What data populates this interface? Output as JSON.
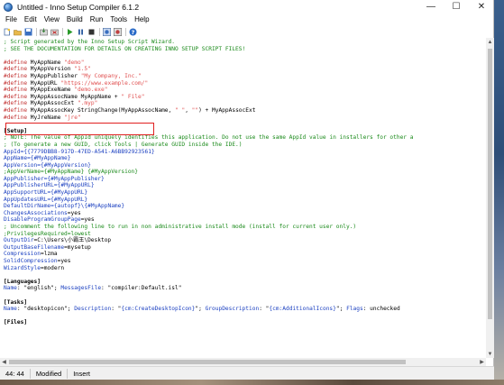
{
  "window": {
    "title": "Untitled - Inno Setup Compiler 6.1.2",
    "controls": {
      "minimize": "—",
      "maximize": "☐",
      "close": "✕"
    }
  },
  "menu": [
    "File",
    "Edit",
    "View",
    "Build",
    "Run",
    "Tools",
    "Help"
  ],
  "toolbar": {
    "icons": [
      "new-icon",
      "open-icon",
      "save-icon",
      "compile-icon",
      "stop-compile-icon",
      "run-icon",
      "pause-icon",
      "terminate-icon",
      "target-icon",
      "debug-icon",
      "help-icon"
    ]
  },
  "editor": {
    "lines": [
      [
        {
          "t": "; Script generated by the Inno Setup Script Wizard.",
          "c": "comment"
        }
      ],
      [
        {
          "t": "; SEE THE DOCUMENTATION FOR DETAILS ON CREATING INNO SETUP SCRIPT FILES!",
          "c": "comment"
        }
      ],
      [
        {
          "t": "",
          "c": "plain"
        }
      ],
      [
        {
          "t": "#define",
          "c": "define"
        },
        {
          "t": " MyAppName ",
          "c": "plain"
        },
        {
          "t": "\"demo\"",
          "c": "str"
        }
      ],
      [
        {
          "t": "#define",
          "c": "define"
        },
        {
          "t": " MyAppVersion ",
          "c": "plain"
        },
        {
          "t": "\"1.5\"",
          "c": "str"
        }
      ],
      [
        {
          "t": "#define",
          "c": "define"
        },
        {
          "t": " MyAppPublisher ",
          "c": "plain"
        },
        {
          "t": "\"My Company, Inc.\"",
          "c": "str"
        }
      ],
      [
        {
          "t": "#define",
          "c": "define"
        },
        {
          "t": " MyAppURL ",
          "c": "plain"
        },
        {
          "t": "\"https://www.example.com/\"",
          "c": "str"
        }
      ],
      [
        {
          "t": "#define",
          "c": "define"
        },
        {
          "t": " MyAppExeName ",
          "c": "plain"
        },
        {
          "t": "\"demo.exe\"",
          "c": "str"
        }
      ],
      [
        {
          "t": "#define",
          "c": "define"
        },
        {
          "t": " MyAppAssocName MyAppName + ",
          "c": "plain"
        },
        {
          "t": "\" File\"",
          "c": "str"
        }
      ],
      [
        {
          "t": "#define",
          "c": "define"
        },
        {
          "t": " MyAppAssocExt ",
          "c": "plain"
        },
        {
          "t": "\".myp\"",
          "c": "str"
        }
      ],
      [
        {
          "t": "#define",
          "c": "define"
        },
        {
          "t": " MyAppAssocKey StringChange(MyAppAssocName, ",
          "c": "plain"
        },
        {
          "t": "\" \"",
          "c": "str"
        },
        {
          "t": ", ",
          "c": "plain"
        },
        {
          "t": "\"\"",
          "c": "str"
        },
        {
          "t": ") + MyAppAssocExt",
          "c": "plain"
        }
      ],
      [
        {
          "t": "#define",
          "c": "define"
        },
        {
          "t": " MyJreName ",
          "c": "plain"
        },
        {
          "t": "\"jre\"",
          "c": "str"
        }
      ],
      [
        {
          "t": "",
          "c": "plain"
        }
      ],
      [
        {
          "t": "[Setup]",
          "c": "sec"
        }
      ],
      [
        {
          "t": "; NOTE: The value of AppId uniquely identifies this application. Do not use the same AppId value in installers for other a",
          "c": "comment"
        }
      ],
      [
        {
          "t": "; (To generate a new GUID, click Tools | Generate GUID inside the IDE.)",
          "c": "comment"
        }
      ],
      [
        {
          "t": "AppId",
          "c": "key"
        },
        {
          "t": "={{7779DBB8-917D-47ED-A541-A6BB92923561}",
          "c": "key"
        }
      ],
      [
        {
          "t": "AppName",
          "c": "key"
        },
        {
          "t": "={#MyAppName}",
          "c": "key"
        }
      ],
      [
        {
          "t": "AppVersion",
          "c": "key"
        },
        {
          "t": "={#MyAppVersion}",
          "c": "key"
        }
      ],
      [
        {
          "t": ";AppVerName={#MyAppName} {#MyAppVersion}",
          "c": "comment"
        }
      ],
      [
        {
          "t": "AppPublisher",
          "c": "key"
        },
        {
          "t": "={#MyAppPublisher}",
          "c": "key"
        }
      ],
      [
        {
          "t": "AppPublisherURL",
          "c": "key"
        },
        {
          "t": "={#MyAppURL}",
          "c": "key"
        }
      ],
      [
        {
          "t": "AppSupportURL",
          "c": "key"
        },
        {
          "t": "={#MyAppURL}",
          "c": "key"
        }
      ],
      [
        {
          "t": "AppUpdatesURL",
          "c": "key"
        },
        {
          "t": "={#MyAppURL}",
          "c": "key"
        }
      ],
      [
        {
          "t": "DefaultDirName",
          "c": "key"
        },
        {
          "t": "={autopf}\\{#MyAppName}",
          "c": "key"
        }
      ],
      [
        {
          "t": "ChangesAssociations",
          "c": "key"
        },
        {
          "t": "=yes",
          "c": "plain"
        }
      ],
      [
        {
          "t": "DisableProgramGroupPage",
          "c": "key"
        },
        {
          "t": "=yes",
          "c": "plain"
        }
      ],
      [
        {
          "t": "; Uncomment the following line to run in non administrative install mode (install for current user only.)",
          "c": "comment"
        }
      ],
      [
        {
          "t": ";PrivilegesRequired=lowest",
          "c": "comment"
        }
      ],
      [
        {
          "t": "OutputDir",
          "c": "key"
        },
        {
          "t": "=C:\\Users\\小霸王\\Desktop",
          "c": "plain"
        }
      ],
      [
        {
          "t": "OutputBaseFilename",
          "c": "key"
        },
        {
          "t": "=mysetup",
          "c": "plain"
        }
      ],
      [
        {
          "t": "Compression",
          "c": "key"
        },
        {
          "t": "=lzma",
          "c": "plain"
        }
      ],
      [
        {
          "t": "SolidCompression",
          "c": "key"
        },
        {
          "t": "=yes",
          "c": "plain"
        }
      ],
      [
        {
          "t": "WizardStyle",
          "c": "key"
        },
        {
          "t": "=modern",
          "c": "plain"
        }
      ],
      [
        {
          "t": "",
          "c": "plain"
        }
      ],
      [
        {
          "t": "[Languages]",
          "c": "sec"
        }
      ],
      [
        {
          "t": "Name",
          "c": "key"
        },
        {
          "t": ": \"english\"; ",
          "c": "plain"
        },
        {
          "t": "MessagesFile",
          "c": "key"
        },
        {
          "t": ": \"compiler:Default.isl\"",
          "c": "plain"
        }
      ],
      [
        {
          "t": "",
          "c": "plain"
        }
      ],
      [
        {
          "t": "[Tasks]",
          "c": "sec"
        }
      ],
      [
        {
          "t": "Name",
          "c": "key"
        },
        {
          "t": ": \"desktopicon\"; ",
          "c": "plain"
        },
        {
          "t": "Description",
          "c": "key"
        },
        {
          "t": ": \"",
          "c": "plain"
        },
        {
          "t": "{cm:CreateDesktopIcon}",
          "c": "key"
        },
        {
          "t": "\"; ",
          "c": "plain"
        },
        {
          "t": "GroupDescription",
          "c": "key"
        },
        {
          "t": ": \"",
          "c": "plain"
        },
        {
          "t": "{cm:AdditionalIcons}",
          "c": "key"
        },
        {
          "t": "\"; ",
          "c": "plain"
        },
        {
          "t": "Flags",
          "c": "key"
        },
        {
          "t": ": unchecked",
          "c": "plain"
        }
      ],
      [
        {
          "t": "",
          "c": "plain"
        }
      ],
      [
        {
          "t": "[Files]",
          "c": "sec"
        }
      ]
    ]
  },
  "status": {
    "position": "44: 44",
    "modified": "Modified",
    "mode": "Insert"
  }
}
